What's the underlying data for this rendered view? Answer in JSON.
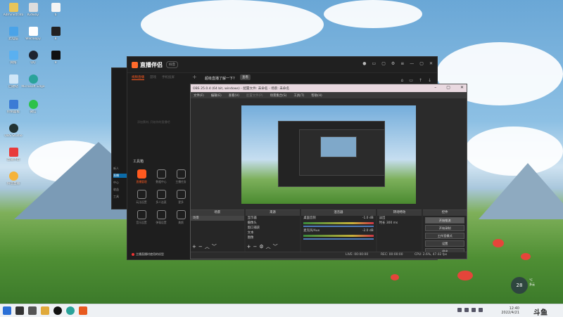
{
  "desktop": {
    "icons": [
      {
        "label": "Administrato"
      },
      {
        "label": "Kidway"
      },
      {
        "label": "6"
      },
      {
        "label": "此电脑"
      },
      {
        "label": "Wilcloopy"
      },
      {
        "label": "8"
      },
      {
        "label": "网络"
      },
      {
        "label": "QQ"
      },
      {
        "label": "9"
      },
      {
        "label": "回收站"
      },
      {
        "label": "Microsoft Edge"
      },
      {
        "label": "控制面板"
      },
      {
        "label": "微信"
      },
      {
        "label": "OBS Studio"
      },
      {
        "label": "直播伴侣"
      },
      {
        "label": "抖音直播"
      }
    ]
  },
  "zb": {
    "title": "直播伴侣",
    "version": "抖音",
    "tabs": [
      "视频直播",
      "游戏",
      "手机投屏"
    ],
    "active_tab": "视频直播",
    "hint": "超级直播了解一下?",
    "hint_button": "查看",
    "empty_text": "添加素材, 开始你的直播吧",
    "tool_title": "工具箱",
    "tools": [
      {
        "label": "直播管理",
        "hot": true
      },
      {
        "label": "数据中心",
        "hot": false
      },
      {
        "label": "主播任务",
        "hot": false
      },
      {
        "label": "玩法设置",
        "hot": false
      },
      {
        "label": "多人连麦",
        "hot": false
      },
      {
        "label": "更多",
        "hot": false
      },
      {
        "label": "音乐设置",
        "hot": false
      },
      {
        "label": "弹幕设置",
        "hot": false
      },
      {
        "label": "美颜",
        "hot": false
      }
    ],
    "footer": "主播直播时使用的机型"
  },
  "side_win": {
    "items": [
      {
        "label": "新人"
      },
      {
        "label": "直播"
      },
      {
        "label": "中心"
      },
      {
        "label": "收益"
      },
      {
        "label": "工具"
      }
    ]
  },
  "obs": {
    "title": "OBS 25.0.4 (64 bit, windows) - 配置文件: 未命名 - 场景: 未命名",
    "menu": [
      "文件(F)",
      "编辑(E)",
      "查看(V)",
      "配置文件(P)",
      "场景集合(S)",
      "工具(T)",
      "帮助(H)"
    ],
    "docks": {
      "scenes": {
        "header": "场景",
        "items": [
          "场景"
        ]
      },
      "sources": {
        "header": "来源",
        "items": [
          "显示器",
          "摄像头",
          "窗口捕获",
          "文本",
          "图像"
        ]
      },
      "mixer": {
        "header": "混音器",
        "tracks": [
          {
            "name": "桌面音频",
            "db": "-1.0 dB"
          },
          {
            "name": "麦克风/Aux",
            "db": "-2.0 dB"
          }
        ]
      },
      "transitions": {
        "header": "转场特效",
        "type": "淡出",
        "duration_label": "时长",
        "duration": "300 ms"
      },
      "controls": {
        "header": "控件",
        "buttons": [
          "开始推流",
          "开始录制",
          "工作室模式",
          "设置",
          "退出"
        ]
      }
    },
    "status": {
      "live": "LIVE: 00:00:00",
      "rec": "REC: 00:00:00",
      "cpu": "CPU: 2.6%, 47.02 fps"
    }
  },
  "widget": {
    "temp": "28",
    "unit": "°C",
    "desc": "多云"
  },
  "taskbar": {
    "time": "12:40",
    "date": "2022/4/21",
    "watermark": "斗鱼"
  }
}
